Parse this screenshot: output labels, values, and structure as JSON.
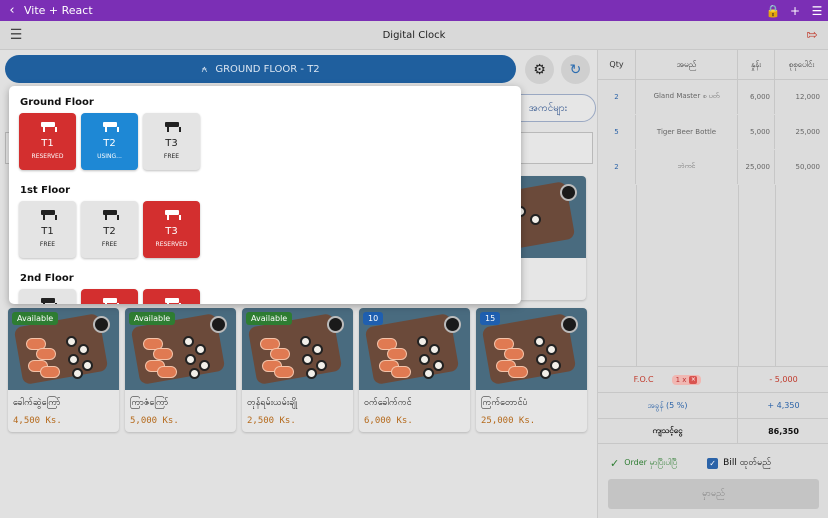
{
  "statusbar": {
    "title": "Vite + React"
  },
  "appbar": {
    "title": "Digital Clock"
  },
  "floor_button": {
    "label": "GROUND FLOOR - T2"
  },
  "category_chip": {
    "label": "အကင်များ"
  },
  "floors": [
    {
      "name": "Ground Floor",
      "tables": [
        {
          "name": "T1",
          "status": "RESERVED",
          "kind": "reserved"
        },
        {
          "name": "T2",
          "status": "USING...",
          "kind": "using"
        },
        {
          "name": "T3",
          "status": "FREE",
          "kind": "free"
        }
      ]
    },
    {
      "name": "1st Floor",
      "tables": [
        {
          "name": "T1",
          "status": "FREE",
          "kind": "free"
        },
        {
          "name": "T2",
          "status": "FREE",
          "kind": "free"
        },
        {
          "name": "T3",
          "status": "RESERVED",
          "kind": "reserved"
        }
      ]
    },
    {
      "name": "2nd Floor",
      "tables": []
    }
  ],
  "products": [
    {
      "name": "ခေါက်ဆွဲကြော်",
      "price": "4,500 Ks.",
      "badge": "Available"
    },
    {
      "name": "ကြာဇံကြော်",
      "price": "5,000 Ks.",
      "badge": "Available"
    },
    {
      "name": "တုန်ရမ်းယမ်းချို",
      "price": "2,500 Ks.",
      "badge": "Available"
    },
    {
      "name": "ဝက်ခေါက်ကင်",
      "price": "6,000 Ks.",
      "badge": "10"
    },
    {
      "name": "ကြက်တောင်ပံ",
      "price": "25,000 Ks.",
      "badge": "15"
    }
  ],
  "order": {
    "headers": {
      "qty": "Qty",
      "name": "အမည်",
      "price": "နှုန်း",
      "total": "စုစုပေါင်း"
    },
    "rows": [
      {
        "qty": "2",
        "name": "Gland Master စ ပတ်",
        "price": "6,000",
        "total": "12,000"
      },
      {
        "qty": "5",
        "name": "Tiger Beer Bottle",
        "price": "5,000",
        "total": "25,000"
      },
      {
        "qty": "2",
        "name": "ဘဲကင်",
        "price": "25,000",
        "total": "50,000"
      }
    ],
    "foc": {
      "label": "F.O.C",
      "count": "1 x",
      "value": "- 5,000"
    },
    "tax": {
      "label": "အခွန် (5 %)",
      "value": "+ 4,350"
    },
    "total": {
      "label": "ကျသင့်ငွေ",
      "value": "86,350"
    },
    "order_done_label": "Order မှာပြီးပါပြီ",
    "bill_print_label": "Bill ထုတ်မည်",
    "order_button_label": "မှာမည်"
  },
  "colors": {
    "brand": "#7b2fb5",
    "reserved": "#d32f2f",
    "using": "#1e88d5",
    "floor_button": "#1f5f9e"
  }
}
